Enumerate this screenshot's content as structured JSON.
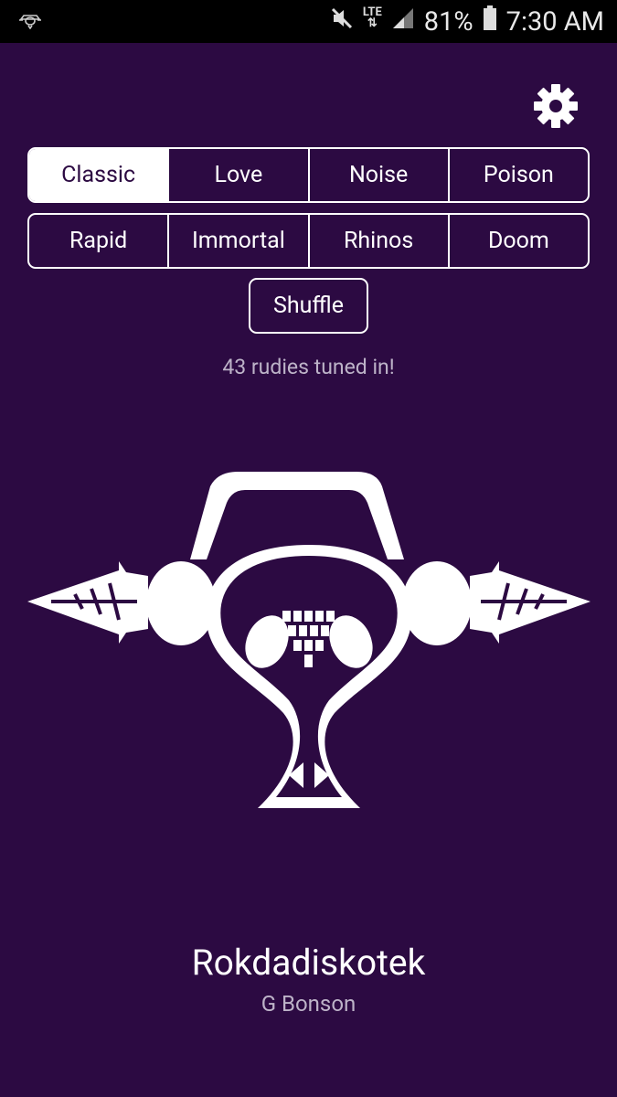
{
  "status_bar": {
    "network": "LTE",
    "battery": "81%",
    "time": "7:30 AM",
    "icons": [
      "app-notification-icon",
      "mute-icon",
      "lte-data-icon",
      "signal-icon",
      "battery-icon"
    ]
  },
  "settings": {
    "icon": "gear-icon"
  },
  "stations": {
    "row1": [
      "Classic",
      "Love",
      "Noise",
      "Poison"
    ],
    "row2": [
      "Rapid",
      "Immortal",
      "Rhinos",
      "Doom"
    ],
    "selected": "Classic"
  },
  "shuffle_label": "Shuffle",
  "listeners_text": "43 rudies tuned in!",
  "now_playing": {
    "title": "Rokdadiskotek",
    "artist": "G Bonson"
  },
  "colors": {
    "background": "#2c0a42",
    "status_bar": "#000000",
    "foreground": "#ffffff",
    "muted_text": "#bdb3c8"
  }
}
